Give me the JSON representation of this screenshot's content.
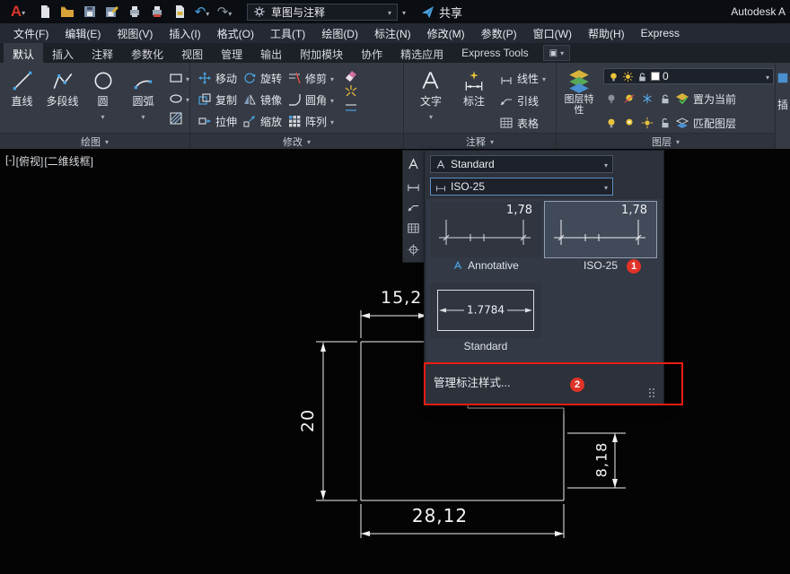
{
  "titlebar": {
    "logo": "A",
    "workspace": "草图与注释",
    "share": "共享",
    "right_text": "Autodesk A"
  },
  "menubar": {
    "items": [
      "文件(F)",
      "编辑(E)",
      "视图(V)",
      "插入(I)",
      "格式(O)",
      "工具(T)",
      "绘图(D)",
      "标注(N)",
      "修改(M)",
      "参数(P)",
      "窗口(W)",
      "帮助(H)",
      "Express"
    ]
  },
  "ribbon": {
    "tabs": [
      {
        "label": "默认"
      },
      {
        "label": "插入"
      },
      {
        "label": "注释"
      },
      {
        "label": "参数化"
      },
      {
        "label": "视图"
      },
      {
        "label": "管理"
      },
      {
        "label": "输出"
      },
      {
        "label": "附加模块"
      },
      {
        "label": "协作"
      },
      {
        "label": "精选应用"
      },
      {
        "label": "Express Tools"
      }
    ],
    "panels": {
      "draw": {
        "label": "绘图",
        "tools": [
          "直线",
          "多段线",
          "圆",
          "圆弧"
        ]
      },
      "modify": {
        "label": "修改",
        "tools": [
          "移动",
          "旋转",
          "修剪",
          "复制",
          "镜像",
          "圆角",
          "拉伸",
          "缩放",
          "阵列"
        ]
      },
      "annotate": {
        "label": "注释",
        "tools": [
          "文字",
          "标注",
          "线性",
          "引线",
          "表格"
        ]
      },
      "layers": {
        "label": "图层",
        "properties": "图层特性",
        "current_layer": "0",
        "set_current": "置为当前",
        "match_layer": "匹配图层"
      },
      "partial": {
        "label": "插"
      }
    }
  },
  "flyout": {
    "text_style": "Standard",
    "dim_style": "ISO-25",
    "gallery": [
      {
        "name": "Annotative",
        "value": "1,78"
      },
      {
        "name": "ISO-25",
        "value": "1,78",
        "badge": "1"
      },
      {
        "name": "Standard",
        "value": "1.7784"
      }
    ],
    "manage_item": "管理标注样式...",
    "manage_badge": "2"
  },
  "viewport": {
    "controls": [
      "[-]",
      "[俯视]",
      "[二维线框]"
    ]
  },
  "drawing": {
    "dimensions": {
      "top": "15,2",
      "left": "20",
      "bottom": "28,12",
      "right": "8,18"
    }
  },
  "colors": {
    "accent_blue": "#4aa3e0",
    "badge_red": "#e03328",
    "highlight_red": "#f01d14",
    "selection": "#414a58"
  }
}
